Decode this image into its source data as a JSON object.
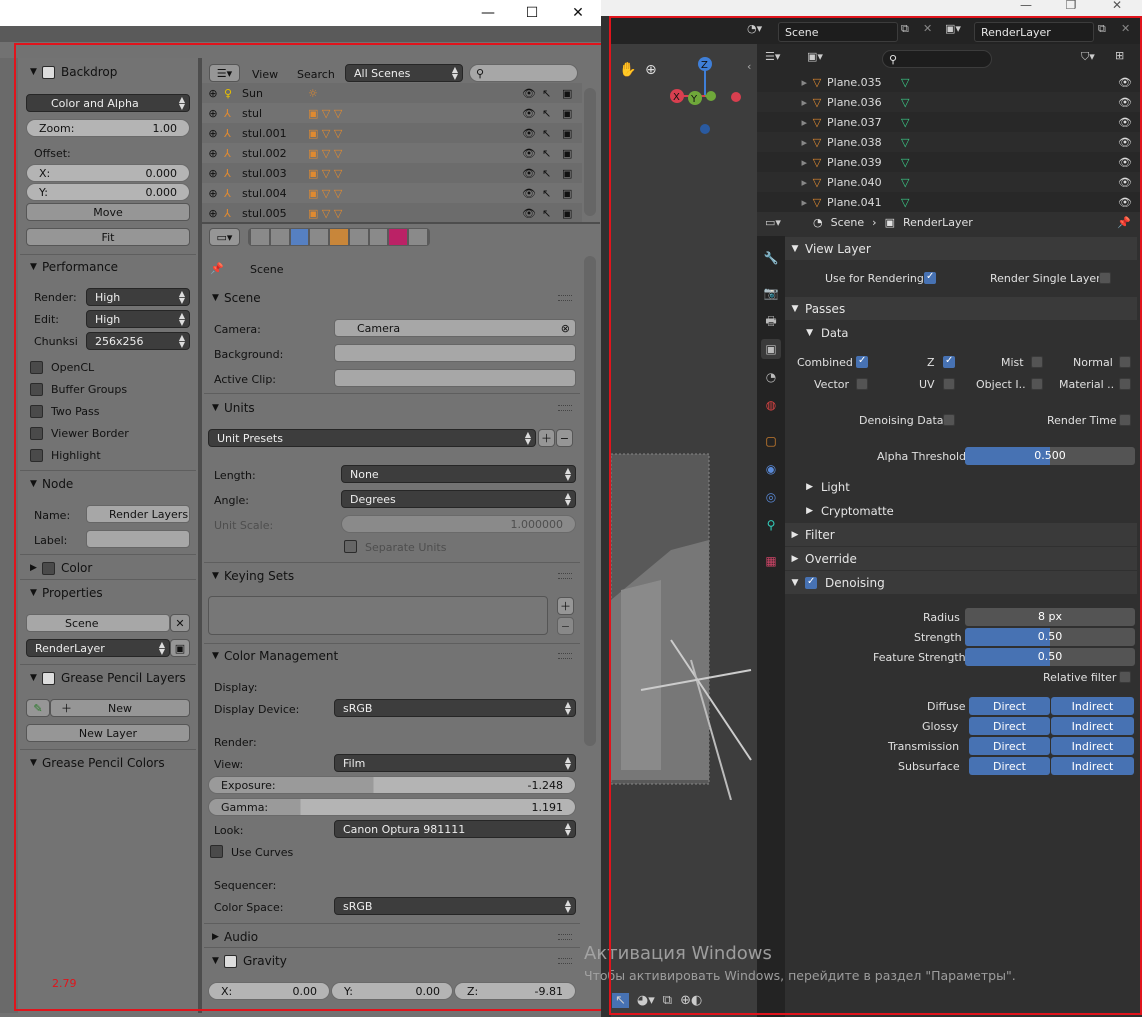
{
  "old_ui": {
    "version_label": "2.79",
    "window_controls": [
      "—",
      "☐",
      "✕"
    ],
    "left": {
      "backdrop": {
        "title": "Backdrop",
        "mode": "Color and Alpha",
        "zoom_label": "Zoom:",
        "zoom_value": "1.00",
        "offset_label": "Offset:",
        "x_label": "X:",
        "x_value": "0.000",
        "y_label": "Y:",
        "y_value": "0.000",
        "move": "Move",
        "fit": "Fit"
      },
      "performance": {
        "title": "Performance",
        "render_label": "Render:",
        "render_value": "High",
        "edit_label": "Edit:",
        "edit_value": "High",
        "chunks_label": "Chunksi",
        "chunks_value": "256x256",
        "checks": [
          "OpenCL",
          "Buffer Groups",
          "Two Pass",
          "Viewer Border",
          "Highlight"
        ]
      },
      "node": {
        "title": "Node",
        "name_label": "Name:",
        "name_value": "Render Layers",
        "label_label": "Label:"
      },
      "color": {
        "title": "Color"
      },
      "properties": {
        "title": "Properties",
        "scene": "Scene",
        "layer": "RenderLayer"
      },
      "gp_layers": {
        "title": "Grease Pencil Layers",
        "new": "New",
        "new_layer": "New Layer"
      },
      "gp_colors": {
        "title": "Grease Pencil Colors"
      }
    },
    "outliner": {
      "view": "View",
      "search": "Search",
      "scenes": "All Scenes",
      "rows": [
        "Sun",
        "stul",
        "stul.001",
        "stul.002",
        "stul.003",
        "stul.004",
        "stul.005"
      ]
    },
    "props": {
      "context": "Scene",
      "scene": {
        "title": "Scene",
        "camera_label": "Camera:",
        "camera_value": "Camera",
        "background_label": "Background:",
        "clip_label": "Active Clip:"
      },
      "units": {
        "title": "Units",
        "presets": "Unit Presets",
        "length_label": "Length:",
        "length_value": "None",
        "angle_label": "Angle:",
        "angle_value": "Degrees",
        "scale_label": "Unit Scale:",
        "scale_value": "1.000000",
        "separate": "Separate Units"
      },
      "keying": {
        "title": "Keying Sets"
      },
      "cm": {
        "title": "Color Management",
        "display": "Display:",
        "device_label": "Display Device:",
        "device_value": "sRGB",
        "render": "Render:",
        "view_label": "View:",
        "view_value": "Film",
        "exposure_label": "Exposure:",
        "exposure_value": "-1.248",
        "gamma_label": "Gamma:",
        "gamma_value": "1.191",
        "look_label": "Look:",
        "look_value": "Canon Optura 981111",
        "curves": "Use Curves",
        "sequencer": "Sequencer:",
        "space_label": "Color Space:",
        "space_value": "sRGB"
      },
      "audio": {
        "title": "Audio"
      },
      "gravity": {
        "title": "Gravity",
        "x_label": "X:",
        "x_value": "0.00",
        "y_label": "Y:",
        "y_value": "0.00",
        "z_label": "Z:",
        "z_value": "-9.81"
      }
    }
  },
  "new_ui": {
    "window_controls": [
      "—",
      "❐",
      "✕"
    ],
    "scene": "Scene",
    "render_layer": "RenderLayer",
    "outliner_rows": [
      "Plane.035",
      "Plane.036",
      "Plane.037",
      "Plane.038",
      "Plane.039",
      "Plane.040",
      "Plane.041"
    ],
    "breadcrumb": {
      "scene": "Scene",
      "layer": "RenderLayer"
    },
    "view_layer": {
      "title": "View Layer",
      "use_rendering": "Use for Rendering",
      "single": "Render Single Layer"
    },
    "passes": {
      "title": "Passes",
      "data": "Data",
      "items": [
        "Combined",
        "Z",
        "Mist",
        "Normal",
        "Vector",
        "UV",
        "Object I..",
        "Material .."
      ],
      "denoising_data": "Denoising Data",
      "render_time": "Render Time",
      "alpha_label": "Alpha Threshold",
      "alpha_value": "0.500",
      "light": "Light",
      "cryptomatte": "Cryptomatte"
    },
    "filter": "Filter",
    "override": "Override",
    "denoising": {
      "title": "Denoising",
      "radius_label": "Radius",
      "radius_value": "8 px",
      "strength_label": "Strength",
      "strength_value": "0.50",
      "feature_label": "Feature Strength",
      "feature_value": "0.50",
      "relative": "Relative filter",
      "rows": [
        "Diffuse",
        "Glossy",
        "Transmission",
        "Subsurface"
      ],
      "direct": "Direct",
      "indirect": "Indirect"
    },
    "watermark_title": "Активация Windows",
    "watermark_text": "Чтобы активировать Windows, перейдите в раздел \"Параметры\"."
  }
}
